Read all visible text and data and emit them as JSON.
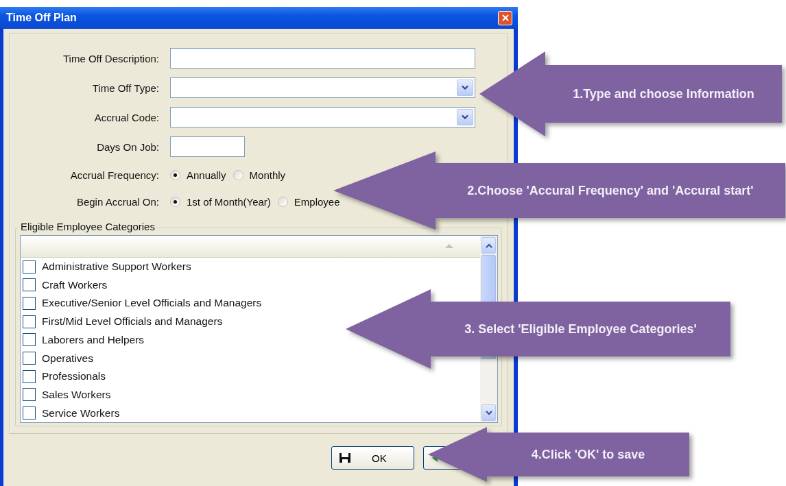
{
  "window": {
    "title": "Time Off Plan"
  },
  "fields": [
    {
      "kind": "text",
      "label": "Time Off Description:"
    },
    {
      "kind": "dropdown",
      "label": "Time Off Type:"
    },
    {
      "kind": "dropdown",
      "label": "Accrual Code:"
    },
    {
      "kind": "short",
      "label": "Days On Job:"
    }
  ],
  "radio_groups": [
    {
      "label": "Accrual Frequency:",
      "options": [
        {
          "label": "Annually",
          "selected": true
        },
        {
          "label": "Monthly",
          "selected": false
        }
      ]
    },
    {
      "label": "Begin Accrual On:",
      "options": [
        {
          "label": "1st of Month(Year)",
          "selected": true
        },
        {
          "label": "Employee",
          "selected": false
        }
      ]
    }
  ],
  "categories": {
    "title": "Eligible Employee Categories",
    "items": [
      {
        "label": "Administrative Support Workers",
        "checked": false
      },
      {
        "label": "Craft Workers",
        "checked": false
      },
      {
        "label": "Executive/Senior Level Officials and Managers",
        "checked": false
      },
      {
        "label": "First/Mid Level Officials and Managers",
        "checked": false
      },
      {
        "label": "Laborers and Helpers",
        "checked": false
      },
      {
        "label": "Operatives",
        "checked": false
      },
      {
        "label": "Professionals",
        "checked": false
      },
      {
        "label": "Sales Workers",
        "checked": false
      },
      {
        "label": "Service Workers",
        "checked": false
      }
    ]
  },
  "buttons": [
    {
      "kind": "save",
      "label": "OK"
    },
    {
      "kind": "back"
    }
  ],
  "callouts": [
    {
      "text": "1.Type and choose Information"
    },
    {
      "text": "2.Choose 'Accural Frequency' and 'Accural start'"
    },
    {
      "text": "3. Select 'Eligible Employee Categories'"
    },
    {
      "text": "4.Click 'OK' to save"
    }
  ]
}
